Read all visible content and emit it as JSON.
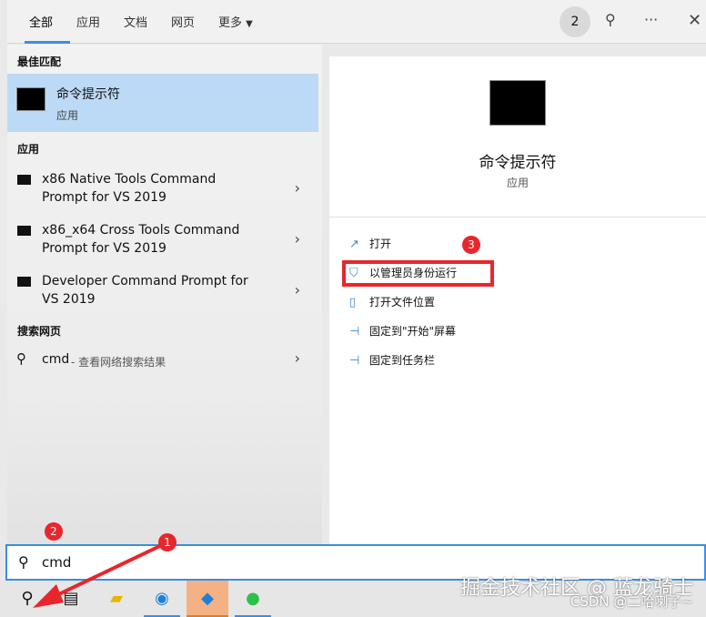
{
  "tabs": [
    "全部",
    "应用",
    "文档",
    "网页",
    "更多"
  ],
  "header": {
    "badge": "2"
  },
  "left": {
    "best_match_heading": "最佳匹配",
    "best_match": {
      "title": "命令提示符",
      "subtitle": "应用"
    },
    "apps_heading": "应用",
    "apps": [
      {
        "line1": "x86 Native Tools Command",
        "line2": "Prompt for VS 2019"
      },
      {
        "line1": "x86_x64 Cross Tools Command",
        "line2": "Prompt for VS 2019"
      },
      {
        "line1": "Developer Command Prompt for",
        "line2": "VS 2019"
      }
    ],
    "web_heading": "搜索网页",
    "web": {
      "query": "cmd",
      "hint": " - 查看网络搜索结果"
    }
  },
  "right": {
    "title": "命令提示符",
    "subtitle": "应用",
    "actions": [
      "打开",
      "以管理员身份运行",
      "打开文件位置",
      "固定到\"开始\"屏幕",
      "固定到任务栏"
    ]
  },
  "annotations": [
    "1",
    "2",
    "3"
  ],
  "search": {
    "value": "cmd"
  },
  "watermark": {
    "line1": "掘金技术社区 @ 蓝龙骑士",
    "line2": "CSDN @二哈喇子~"
  }
}
